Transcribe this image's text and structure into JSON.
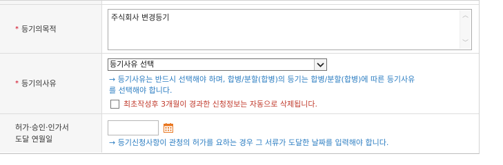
{
  "rows": {
    "purpose": {
      "required_mark": "*",
      "label": "등기의목적",
      "value": "주식회사 변경등기"
    },
    "reason": {
      "required_mark": "*",
      "label": "등기의사유",
      "select_value": "등기사유 선택",
      "notice_line1": "→ 등기사유는 반드시 선택해야 하며, 합병/분할(합병)의 등기는 합병/분할(합병)에 따른 등기사유",
      "notice_line2": "를 선택해야 합니다.",
      "checkbox_label": "최초작성후 3개월이 경과한 신청정보는 자동으로 삭제됩니다."
    },
    "arrival": {
      "label_line1": "허가·승인·인가서",
      "label_line2": "도달 연월일",
      "date_value": "",
      "notice": "→ 등기신청사항이 관청의 허가를 요하는 경우 그 서류가 도달한 날짜를 입력해야 합니다."
    }
  },
  "colors": {
    "required": "#d0021b",
    "notice": "#2a7cc1",
    "warning": "#c0392b",
    "calendar_icon": "#e87722"
  },
  "icons": [
    "chevron-up-icon",
    "chevron-down-icon",
    "dropdown-arrow-icon",
    "calendar-icon"
  ]
}
